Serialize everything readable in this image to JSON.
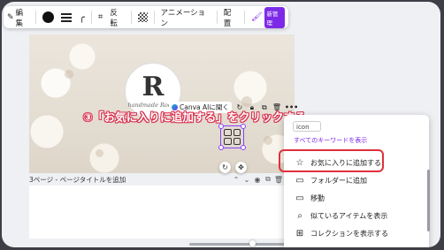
{
  "toolbar": {
    "edit_label": "編集",
    "flip_label": "反転",
    "animation_label": "アニメーション",
    "arrange_label": "配置",
    "new_badge": "新管理"
  },
  "canvas": {
    "logo_letter": "R",
    "logo_subtitle": "handmade Rocha"
  },
  "float_toolbar": {
    "canva_ai_label": "Canva AIに聞く"
  },
  "annotation": {
    "text": "③「お気に入りに追加する」をクリックする"
  },
  "page_row": {
    "label": "3ページ - ページタイトルを追加"
  },
  "context_menu": {
    "search_value": "icon",
    "all_keywords_link": "すべてのキーワードを表示",
    "items": [
      {
        "icon": "star-icon",
        "label": "お気に入りに追加する"
      },
      {
        "icon": "folder-icon",
        "label": "フォルダーに追加"
      },
      {
        "icon": "folder-move-icon",
        "label": "移動"
      },
      {
        "icon": "search-icon",
        "label": "似ているアイテムを表示"
      },
      {
        "icon": "collection-icon",
        "label": "コレクションを表示する"
      }
    ]
  },
  "colors": {
    "accent": "#7d2ae8",
    "highlight_border": "#e0303c",
    "selection": "#8b3dff"
  }
}
